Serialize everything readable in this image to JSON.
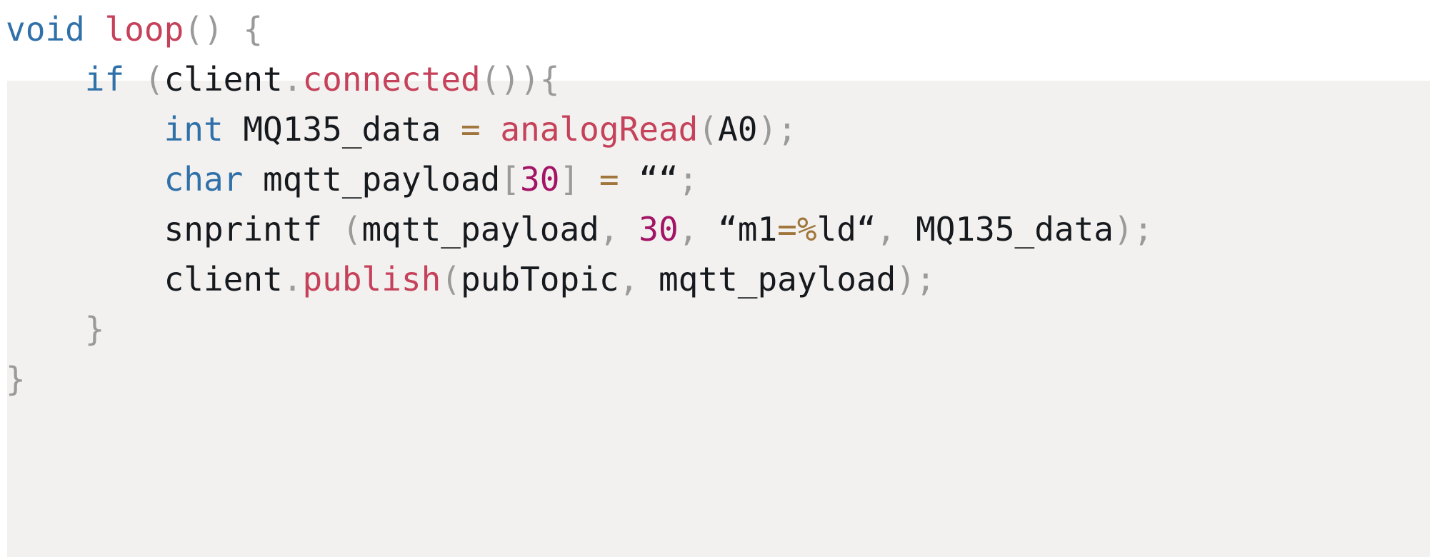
{
  "figure": {
    "kind": "source-code-snippet",
    "language": "arduino-c",
    "shaded_background": "#f2f1ef",
    "page_background": "#ffffff"
  },
  "palette": {
    "keyword": "#3071a9",
    "function": "#c6415a",
    "punctuation": "#9a9a9a",
    "identifier": "#16191d",
    "number": "#a31366",
    "operator": "#a0763c",
    "string": "#16191d"
  },
  "code": {
    "lines": [
      {
        "id": "line-1",
        "indent": "",
        "tokens": [
          {
            "t": "void",
            "c": "t-kw"
          },
          {
            "t": " ",
            "c": "t-id"
          },
          {
            "t": "loop",
            "c": "t-fn"
          },
          {
            "t": "()",
            "c": "t-punct"
          },
          {
            "t": " ",
            "c": "t-id"
          },
          {
            "t": "{",
            "c": "t-punct"
          }
        ]
      },
      {
        "id": "line-2",
        "indent": "    ",
        "tokens": [
          {
            "t": "if",
            "c": "t-kw"
          },
          {
            "t": " ",
            "c": "t-id"
          },
          {
            "t": "(",
            "c": "t-punct"
          },
          {
            "t": "client",
            "c": "t-id"
          },
          {
            "t": ".",
            "c": "t-punct"
          },
          {
            "t": "connected",
            "c": "t-fn"
          },
          {
            "t": "()){",
            "c": "t-punct"
          }
        ]
      },
      {
        "id": "line-3",
        "indent": "        ",
        "tokens": [
          {
            "t": "int",
            "c": "t-kw"
          },
          {
            "t": " MQ135_data ",
            "c": "t-id"
          },
          {
            "t": "=",
            "c": "t-op"
          },
          {
            "t": " ",
            "c": "t-id"
          },
          {
            "t": "analogRead",
            "c": "t-fn"
          },
          {
            "t": "(",
            "c": "t-punct"
          },
          {
            "t": "A0",
            "c": "t-id"
          },
          {
            "t": ");",
            "c": "t-punct"
          }
        ]
      },
      {
        "id": "line-4",
        "indent": "        ",
        "tokens": [
          {
            "t": "char",
            "c": "t-kw"
          },
          {
            "t": " mqtt_payload",
            "c": "t-id"
          },
          {
            "t": "[",
            "c": "t-punct"
          },
          {
            "t": "30",
            "c": "t-num"
          },
          {
            "t": "]",
            "c": "t-punct"
          },
          {
            "t": " ",
            "c": "t-id"
          },
          {
            "t": "=",
            "c": "t-op"
          },
          {
            "t": " ",
            "c": "t-id"
          },
          {
            "t": "““",
            "c": "t-str"
          },
          {
            "t": ";",
            "c": "t-punct"
          }
        ]
      },
      {
        "id": "line-5",
        "indent": "        ",
        "tokens": [
          {
            "t": "snprintf",
            "c": "t-id"
          },
          {
            "t": " ",
            "c": "t-id"
          },
          {
            "t": "(",
            "c": "t-punct"
          },
          {
            "t": "mqtt_payload",
            "c": "t-id"
          },
          {
            "t": ",",
            "c": "t-punct"
          },
          {
            "t": " ",
            "c": "t-id"
          },
          {
            "t": "30",
            "c": "t-num"
          },
          {
            "t": ",",
            "c": "t-punct"
          },
          {
            "t": " ",
            "c": "t-id"
          },
          {
            "t": "“m1",
            "c": "t-str"
          },
          {
            "t": "=%",
            "c": "t-op"
          },
          {
            "t": "ld“",
            "c": "t-str"
          },
          {
            "t": ",",
            "c": "t-punct"
          },
          {
            "t": " ",
            "c": "t-id"
          },
          {
            "t": "MQ135_data",
            "c": "t-id"
          },
          {
            "t": ");",
            "c": "t-punct"
          }
        ]
      },
      {
        "id": "line-6",
        "indent": "        ",
        "tokens": [
          {
            "t": "client",
            "c": "t-id"
          },
          {
            "t": ".",
            "c": "t-punct"
          },
          {
            "t": "publish",
            "c": "t-fn"
          },
          {
            "t": "(",
            "c": "t-punct"
          },
          {
            "t": "pubTopic",
            "c": "t-id"
          },
          {
            "t": ",",
            "c": "t-punct"
          },
          {
            "t": " ",
            "c": "t-id"
          },
          {
            "t": "mqtt_payload",
            "c": "t-id"
          },
          {
            "t": ");",
            "c": "t-punct"
          }
        ]
      },
      {
        "id": "line-7",
        "indent": "    ",
        "tokens": [
          {
            "t": "}",
            "c": "t-punct"
          }
        ]
      },
      {
        "id": "line-8",
        "indent": "",
        "tokens": [
          {
            "t": "}",
            "c": "t-punct"
          }
        ]
      }
    ],
    "plain_text": "void loop() {\n    if (client.connected()){\n        int MQ135_data = analogRead(A0);\n        char mqtt_payload[30] = ““;\n        snprintf (mqtt_payload, 30, “m1=%ld“, MQ135_data);\n        client.publish(pubTopic, mqtt_payload);\n    }\n}"
  }
}
